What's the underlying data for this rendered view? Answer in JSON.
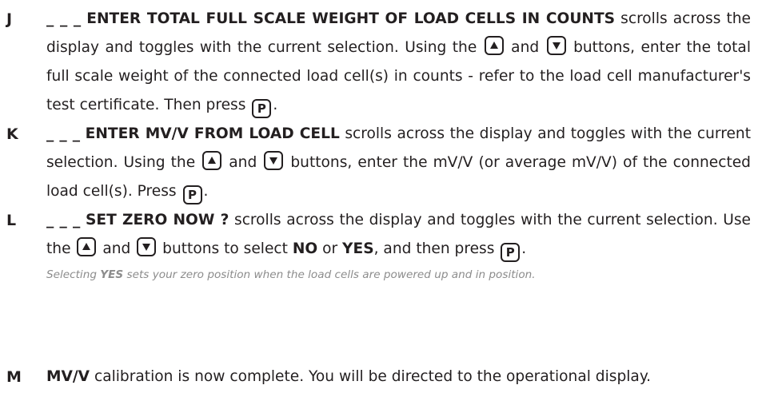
{
  "steps": [
    {
      "letter": "J",
      "prefix": "_ _ _",
      "heading": "ENTER TOTAL FULL SCALE WEIGHT OF LOAD CELLS IN COUNTS",
      "t1": " scrolls across the display and toggles with the current selection. Using the ",
      "t2": " and ",
      "t3": " buttons, enter the total full scale weight of the connected load cell(s) in counts - refer to the load cell manufacturer's test certificate. Then press ",
      "t4": "."
    },
    {
      "letter": "K",
      "prefix": "_ _ _",
      "heading": "ENTER MV/V FROM LOAD CELL",
      "t1": " scrolls across the display and toggles with the current selection. Using the ",
      "t2": " and ",
      "t3": " buttons, enter the mV/V (or average mV/V) of the connected load cell(s). Press ",
      "t4": "."
    },
    {
      "letter": "L",
      "prefix": "_ _ _",
      "heading": "SET ZERO NOW ?",
      "t1": " scrolls across the display and toggles with the current selection. Use the ",
      "t2": " and ",
      "t3": " buttons to select ",
      "opt_no": "NO",
      "t4": " or ",
      "opt_yes": "YES",
      "t5": ", and then press ",
      "t6": ".",
      "note_pre": "Selecting ",
      "note_yes": "YES",
      "note_post": " sets your zero position when the load cells are powered up and in position."
    },
    {
      "letter": "M",
      "heading": "MV/V",
      "t1": " calibration is now complete. You will be directed to the operational display."
    }
  ],
  "keys": {
    "up_icon": "up-arrow-key-icon",
    "down_icon": "down-arrow-key-icon",
    "program_label": "P"
  }
}
